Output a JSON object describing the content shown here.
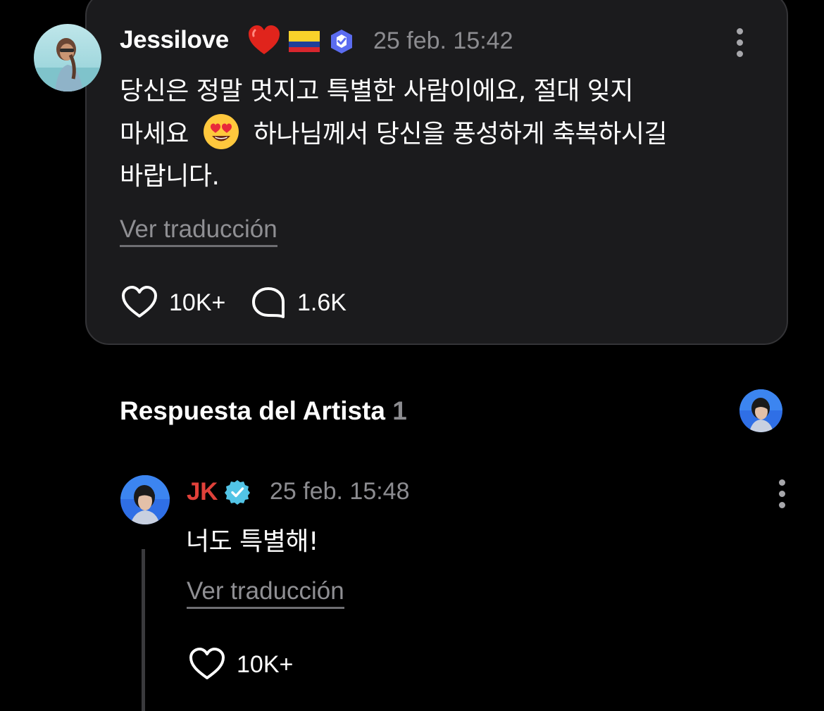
{
  "comment": {
    "username": "Jessilove",
    "heart_emoji": "❤️",
    "timestamp": "25 feb. 15:42",
    "text_line1": "당신은 정말 멋지고 특별한 사람이에요, 절대 잊지",
    "text_line2_a": "마세요",
    "text_emoji": "😍",
    "text_line2_b": "하나님께서 당신을 풍성하게 축복하시길",
    "text_line3": "바랍니다.",
    "translate_label": "Ver traducción",
    "likes": "10K+",
    "replies": "1.6K"
  },
  "artist_section": {
    "title": "Respuesta del Artista",
    "count": "1"
  },
  "reply": {
    "username": "JK",
    "timestamp": "25 feb. 15:48",
    "text": "너도 특별해!",
    "translate_label": "Ver traducción",
    "likes": "10K+"
  },
  "colors": {
    "background": "#000000",
    "card": "#1b1b1d",
    "artist_name": "#e0413a",
    "verified_badge": "#4a7df0",
    "artist_badge": "#52c4e6",
    "muted_text": "#8c8c90"
  },
  "icons": {
    "flag": "colombia-flag-icon",
    "verified": "verified-badge-icon",
    "like": "heart-outline-icon",
    "reply": "speech-bubble-icon",
    "menu": "kebab-menu-icon"
  }
}
